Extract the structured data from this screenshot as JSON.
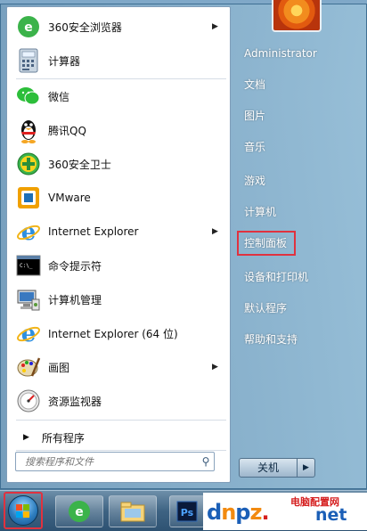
{
  "left_items": [
    {
      "label": "360安全浏览器",
      "icon": "360-browser-icon",
      "has_arrow": true
    },
    {
      "label": "计算器",
      "icon": "calculator-icon",
      "has_arrow": false
    },
    {
      "label": "微信",
      "icon": "wechat-icon",
      "has_arrow": false
    },
    {
      "label": "腾讯QQ",
      "icon": "qq-icon",
      "has_arrow": false
    },
    {
      "label": "360安全卫士",
      "icon": "360-security-icon",
      "has_arrow": false
    },
    {
      "label": "VMware",
      "icon": "vmware-icon",
      "has_arrow": false
    },
    {
      "label": "Internet Explorer",
      "icon": "ie-icon",
      "has_arrow": true
    },
    {
      "label": "命令提示符",
      "icon": "cmd-icon",
      "has_arrow": false
    },
    {
      "label": "计算机管理",
      "icon": "computer-management-icon",
      "has_arrow": false
    },
    {
      "label": "Internet Explorer (64 位)",
      "icon": "ie-icon",
      "has_arrow": false
    },
    {
      "label": "画图",
      "icon": "paint-icon",
      "has_arrow": true
    },
    {
      "label": "资源监视器",
      "icon": "resource-monitor-icon",
      "has_arrow": false
    }
  ],
  "all_programs": "所有程序",
  "search_placeholder": "搜索程序和文件",
  "right_items": [
    "Administrator",
    "文档",
    "图片",
    "音乐",
    "游戏",
    "计算机",
    "控制面板",
    "设备和打印机",
    "默认程序",
    "帮助和支持"
  ],
  "shutdown_label": "关机",
  "watermark": {
    "top_text": "电脑配置网",
    "main_d": "d",
    "main_n": "n",
    "main_p": "p",
    "main_z": "z",
    "main_dot": ".",
    "main_net": "net"
  },
  "colors": {
    "highlight": "#e0323f",
    "accent": "#1b5fb7"
  }
}
